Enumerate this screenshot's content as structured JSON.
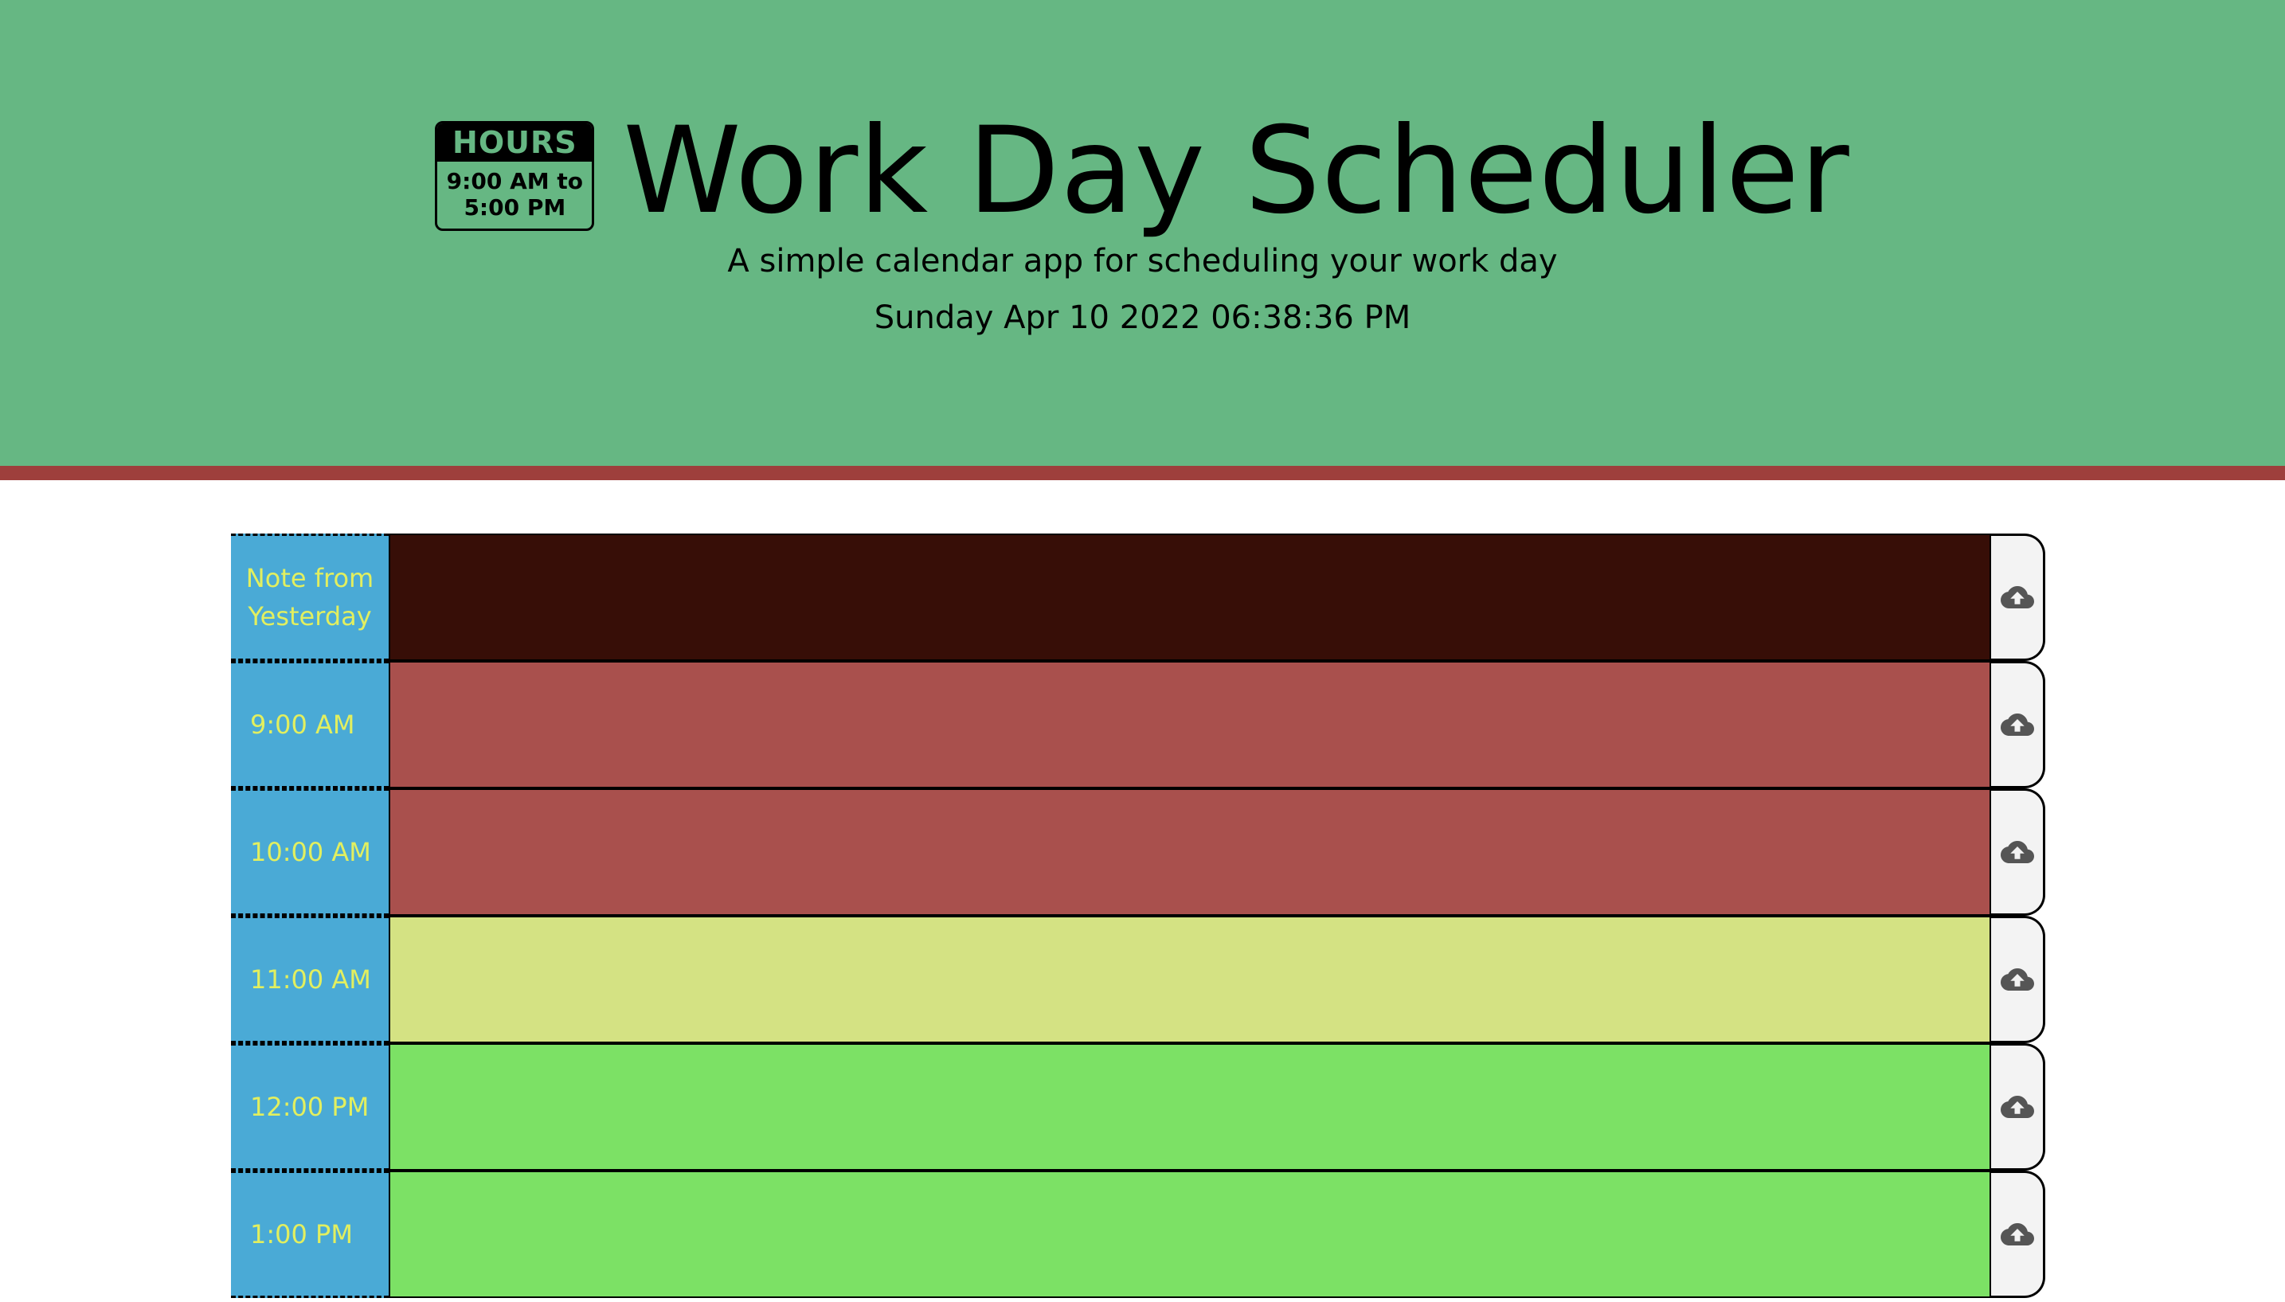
{
  "header": {
    "badge": {
      "top": "HOURS",
      "line1": "9:00 AM to",
      "line2": "5:00 PM"
    },
    "title": "Work Day Scheduler",
    "subtitle": "A simple calendar app for scheduling your work day",
    "datetime": "Sunday Apr 10 2022 06:38:36 PM"
  },
  "colors": {
    "header_bg": "#66b783",
    "header_border": "#9e3f3c",
    "hour_bg": "#4aaad6",
    "hour_text": "#e2ef5f",
    "note": "#370e07",
    "past": "#a9504d",
    "present": "#d4e283",
    "future": "#7ce165",
    "save_bg": "#f3f3f3"
  },
  "rows": [
    {
      "label": "Note from Yesterday",
      "state": "note",
      "text": ""
    },
    {
      "label": "9:00 AM",
      "state": "past",
      "text": ""
    },
    {
      "label": "10:00 AM",
      "state": "past",
      "text": ""
    },
    {
      "label": "11:00 AM",
      "state": "present",
      "text": ""
    },
    {
      "label": "12:00 PM",
      "state": "future",
      "text": ""
    },
    {
      "label": "1:00 PM",
      "state": "future",
      "text": ""
    }
  ],
  "save_icon": "cloud-upload-icon"
}
